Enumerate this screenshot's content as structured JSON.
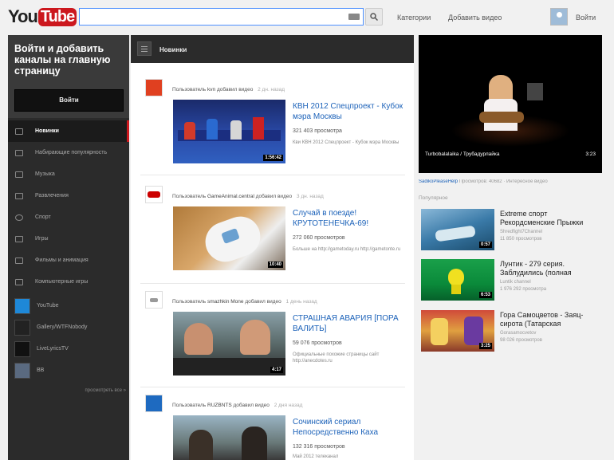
{
  "header": {
    "logo_you": "You",
    "logo_tube": "Tube",
    "search_value": "",
    "links": [
      "Категории",
      "Добавить видео"
    ],
    "signin": "Войти"
  },
  "sidebar": {
    "signin_text": "Войти и добавить каналы на главную страницу",
    "signin_button": "Войти",
    "nav": [
      {
        "label": "Новинки",
        "icon": "list-icon",
        "active": true
      },
      {
        "label": "Набирающие популярность",
        "icon": "trending-icon",
        "active": false
      },
      {
        "label": "Музыка",
        "icon": "headphones-icon",
        "active": false
      },
      {
        "label": "Развлечения",
        "icon": "film-icon",
        "active": false
      },
      {
        "label": "Спорт",
        "icon": "ball-icon",
        "active": false
      },
      {
        "label": "Игры",
        "icon": "gamepad-icon",
        "active": false
      },
      {
        "label": "Фильмы и анимация",
        "icon": "clapper-icon",
        "active": false
      },
      {
        "label": "Компьютерные игры",
        "icon": "joystick-icon",
        "active": false
      }
    ],
    "channels": [
      "YouTube",
      "Gallery/WTFNobody",
      "LiveLyricsTV",
      "ВВ"
    ],
    "see_all": "просмотреть все »"
  },
  "feed": {
    "title": "Новинки",
    "items": [
      {
        "user_prefix": "Пользователь",
        "user": "kvn",
        "action": "добавил видео",
        "time": "2 дн. назад",
        "title": "КВН 2012 Спецпроект - Кубок мэра Москвы",
        "views": "321 403 просмотра",
        "desc": "Кви КВН 2012 Спецпроект - Кубок мэра Москвы",
        "duration": "1:56:42"
      },
      {
        "user_prefix": "Пользователь",
        "user": "GameAnimal.central",
        "action": "добавил видео",
        "time": "3 дн. назад",
        "title": "Случай в поезде! КРУТОТЕНЕЧКА-69!",
        "views": "272 060 просмотров",
        "desc": "Больше на http://gametoday.ru http://gametonte.ru",
        "duration": "10:40"
      },
      {
        "user_prefix": "Пользователь",
        "user": "smazhkin Mone",
        "action": "добавил видео",
        "time": "1 день назад",
        "title": "СТРАШНАЯ АВАРИЯ [ПОРА ВАЛИТЬ]",
        "views": "59 076 просмотров",
        "desc": "Официальные похожие страницы сайт http://anecdotes.ru",
        "duration": "4:17"
      },
      {
        "user_prefix": "Пользователь",
        "user": "RUZBNTS",
        "action": "добавил видео",
        "time": "2 дня назад",
        "title": "Сочинский сериал Непосредственно Каха",
        "views": "132 316 просмотров",
        "desc": "Май 2012 телеканал",
        "duration": ""
      }
    ]
  },
  "player": {
    "title": "Turbobalalaika / Трубадурлайка",
    "time": "3:23",
    "meta_channel": "SadikoPleaseHelp",
    "meta_rest": "Просмотров: 40682 · Интересное видео"
  },
  "recommended": {
    "heading": "Популярное",
    "items": [
      {
        "title": "Extreme спорт Рекордсменские Прыжки",
        "channel": "Shredfight7Channel",
        "views": "11 850 просмотров",
        "duration": "0:57"
      },
      {
        "title": "Лунтик - 279 серия. Заблудились (полная",
        "channel": "Luntik channel",
        "views": "1 976 292 просмотра",
        "duration": "6:53"
      },
      {
        "title": "Гора Самоцветов - Заяц-сирота (Татарская",
        "channel": "Gorasamocvetov",
        "views": "98 026 просмотров",
        "duration": "3:25"
      }
    ]
  }
}
